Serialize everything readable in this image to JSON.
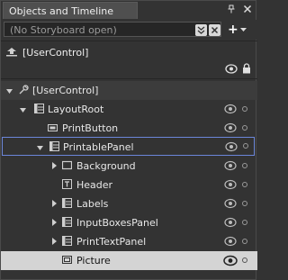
{
  "panel": {
    "title": "Objects and Timeline"
  },
  "storyboard": {
    "placeholder": "(No Storyboard open)",
    "add_label": "+"
  },
  "scope": {
    "label": "[UserControl]"
  },
  "tree": {
    "root_label": "[UserControl]",
    "items": [
      {
        "label": "LayoutRoot"
      },
      {
        "label": "PrintButton"
      },
      {
        "label": "PrintablePanel"
      },
      {
        "label": "Background"
      },
      {
        "label": "Header"
      },
      {
        "label": "Labels"
      },
      {
        "label": "InputBoxesPanel"
      },
      {
        "label": "PrintTextPanel"
      },
      {
        "label": "Picture"
      }
    ]
  },
  "colors": {
    "background": "#333333",
    "selection_border": "#6b86d9",
    "hover_row": "#d4d4d4"
  }
}
